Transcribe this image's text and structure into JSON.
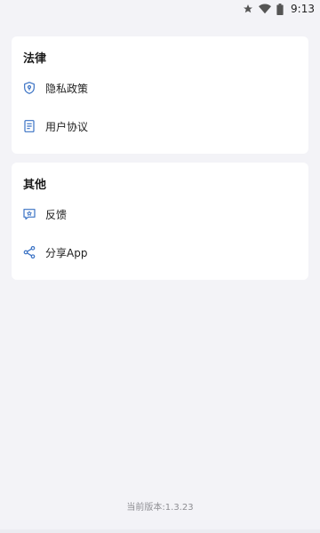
{
  "status_bar": {
    "time": "9:13",
    "icons": [
      "star-icon",
      "wifi-icon",
      "battery-icon"
    ]
  },
  "sections": [
    {
      "title": "法律",
      "items": [
        {
          "label": "隐私政策",
          "icon": "privacy-shield-icon"
        },
        {
          "label": "用户协议",
          "icon": "document-icon"
        }
      ]
    },
    {
      "title": "其他",
      "items": [
        {
          "label": "反馈",
          "icon": "feedback-icon"
        },
        {
          "label": "分享App",
          "icon": "share-icon"
        }
      ]
    }
  ],
  "footer": {
    "version_text": "当前版本:1.3.23"
  },
  "colors": {
    "background": "#f3f3f7",
    "card": "#ffffff",
    "icon_accent": "#3a72c4",
    "muted_text": "#8e8e93"
  }
}
